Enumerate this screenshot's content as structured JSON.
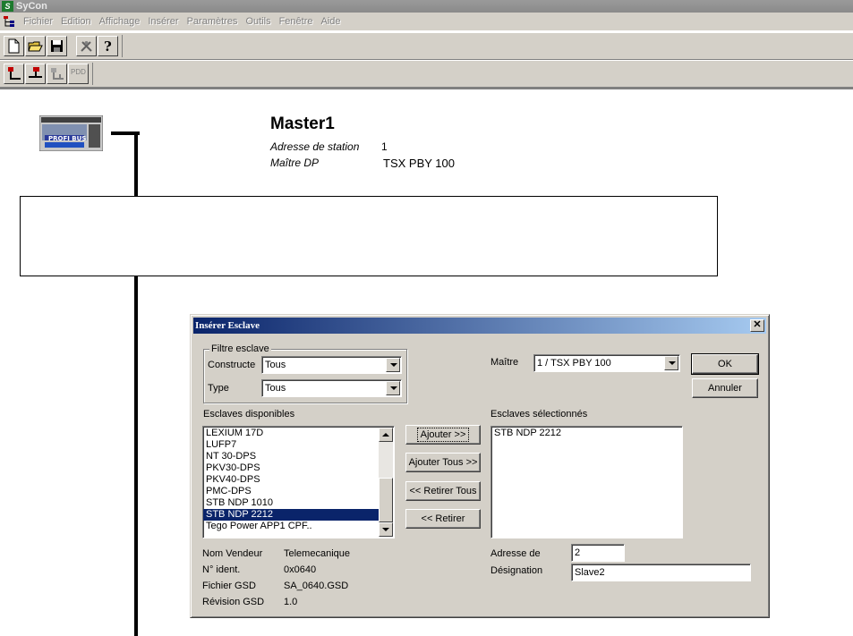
{
  "app": {
    "title": "SyCon"
  },
  "menu": [
    "Fichier",
    "Edition",
    "Affichage",
    "Insérer",
    "Paramètres",
    "Outils",
    "Fenêtre",
    "Aide"
  ],
  "toolbar2": {
    "pdd_label": "PDD"
  },
  "master": {
    "name": "Master1",
    "station_label": "Adresse de station",
    "station_value": "1",
    "type_label": "Maître DP",
    "type_value": "TSX PBY 100",
    "image_text": "PROFI BUS"
  },
  "dialog": {
    "title": "Insérer Esclave",
    "filter_legend": "Filtre esclave",
    "constructor_label": "Constructeur",
    "constructor_value": "Tous",
    "type_label": "Type",
    "type_value": "Tous",
    "master_label": "Maître",
    "master_value": "1 / TSX PBY 100",
    "ok_label": "OK",
    "cancel_label": "Annuler",
    "available_label": "Esclaves disponibles",
    "available": [
      "LEXIUM 17D",
      "LUFP7",
      "NT 30-DPS",
      "PKV30-DPS",
      "PKV40-DPS",
      "PMC-DPS",
      "STB NDP 1010",
      "STB NDP 2212",
      "Tego Power APP1 CPF.."
    ],
    "selected_available_index": 7,
    "selected_label": "Esclaves sélectionnés",
    "selected": [
      "STB NDP 2212"
    ],
    "add_label": "Ajouter >>",
    "add_all_label": "Ajouter Tous >>",
    "remove_all_label": "<< Retirer Tous",
    "remove_label": "<< Retirer",
    "vendor_label": "Nom Vendeur",
    "vendor_value": "Telemecanique",
    "ident_label": "N° ident.",
    "ident_value": "0x0640",
    "gsd_label": "Fichier GSD",
    "gsd_value": "SA_0640.GSD",
    "revision_label": "Révision GSD",
    "revision_value": "1.0",
    "address_label": "Adresse de",
    "address_value": "2",
    "designation_label": "Désignation",
    "designation_value": "Slave2"
  }
}
